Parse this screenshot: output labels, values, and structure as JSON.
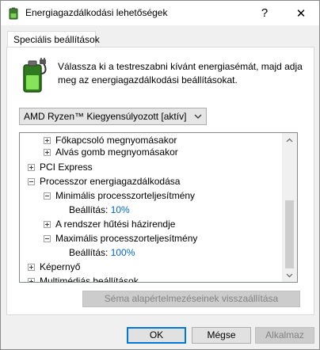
{
  "window": {
    "title": "Energiagazdálkodási lehetőségek",
    "help_glyph": "?",
    "close_glyph": "✕"
  },
  "tab": {
    "label": "Speciális beállítások"
  },
  "description": "Válassza ki a testreszabni kívánt energiasémát, majd adja meg az energiagazdálkodási beállításokat.",
  "plan_select": {
    "value": "AMD Ryzen™ Kiegyensúlyozott [aktív]"
  },
  "tree": {
    "items": [
      {
        "label": "Főkapcsoló megnyomásakor",
        "expander": "plus"
      },
      {
        "label": "Alvás gomb megnyomásakor",
        "expander": "plus"
      },
      {
        "label": "PCI Express",
        "expander": "plus"
      },
      {
        "label": "Processzor energiagazdálkodása",
        "expander": "minus"
      },
      {
        "label": "Minimális processzorteljesítmény",
        "expander": "minus"
      },
      {
        "label": "Beállítás:",
        "value": "10%"
      },
      {
        "label": "A rendszer hűtési házirendje",
        "expander": "plus"
      },
      {
        "label": "Maximális processzorteljesítmény",
        "expander": "minus"
      },
      {
        "label": "Beállítás:",
        "value": "100%"
      },
      {
        "label": "Képernyő",
        "expander": "plus"
      },
      {
        "label": "Multimédiás beállítások",
        "expander": "plus"
      }
    ]
  },
  "buttons": {
    "restore": "Séma alapértelmezéseinek visszaállítása",
    "ok": "OK",
    "cancel": "Mégse",
    "apply": "Alkalmaz"
  },
  "icons": {
    "window_icon": "power-options-icon",
    "battery": "battery-plug-icon"
  }
}
